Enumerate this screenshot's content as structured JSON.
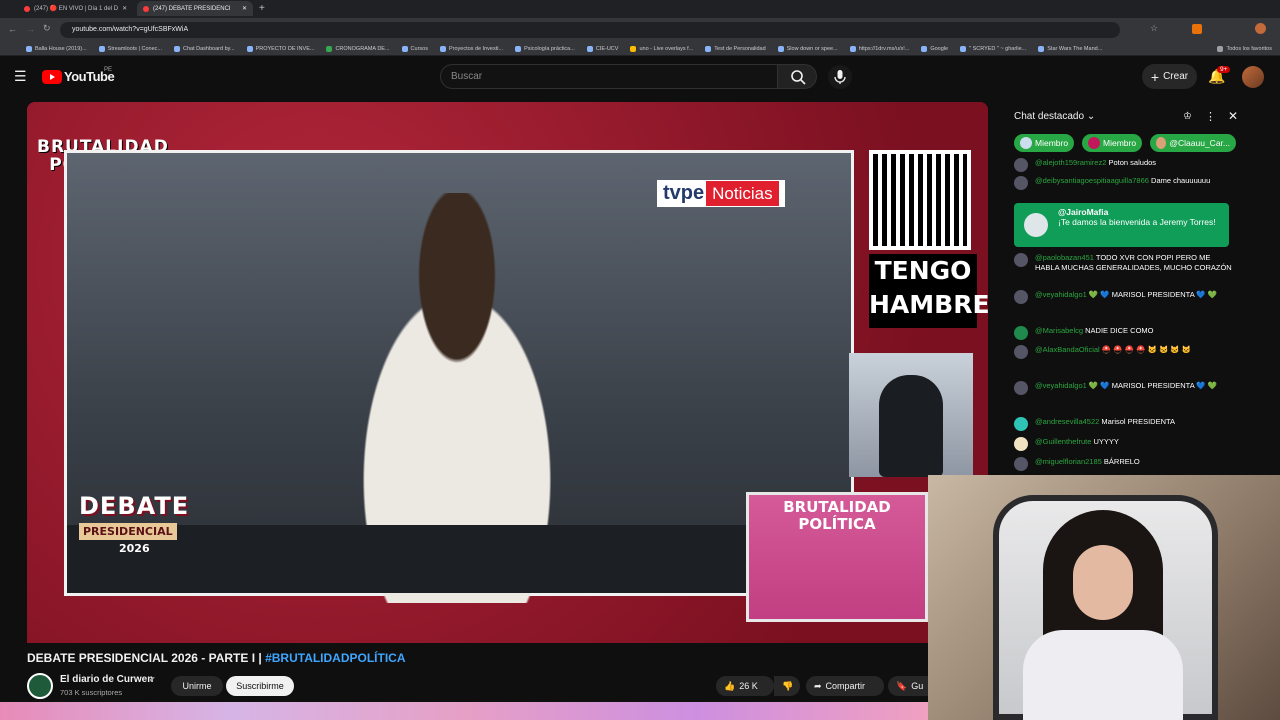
{
  "browser": {
    "tabs": [
      {
        "label": "(247) 🔴 EN VIVO | Día 1 del D"
      },
      {
        "label": "(247) DEBATE PRESIDENCI"
      }
    ],
    "url": "youtube.com/watch?v=gUfcSBFxWiA",
    "bookmarks": [
      "Balla House (2019)...",
      "Streamloots | Conec...",
      "Chat Dashboard by...",
      "PROYECTO DE INVE...",
      "CRONOGRAMA DE...",
      "Cursos",
      "Proyectos de Investi...",
      "Psicología práctica...",
      "CIE-UCV",
      "uno - Live overlays f...",
      "Test de Personalidad",
      "Slow down or spee...",
      "https://1drv.ms/u/s!...",
      "Google",
      "\" SCRYED \" ~ gharlie...",
      "Star Wars The Mand..."
    ],
    "all_bookmarks": "Todos los favoritos"
  },
  "youtube": {
    "logo": "YouTube",
    "country": "PE",
    "search_placeholder": "Buscar",
    "create_label": "Crear",
    "notif_count": "9+"
  },
  "video": {
    "brand_overlay": "BRUTALIDAD POLÍTICA",
    "tvpe": "tvpe",
    "tvpe_news": "Noticias",
    "tengo": "TENGO",
    "hambre": "HAMBRE",
    "debate": "DEBATE",
    "presidencial": "PRESIDENCIAL",
    "year": "2026",
    "pip_text": "BRUTALIDAD POLÍTICA"
  },
  "meta": {
    "title": "DEBATE PRESIDENCIAL 2026 - PARTE I | ",
    "hashtag": "#BRUTALIDADPOLÍTICA",
    "channel": "El diario de Curwen",
    "subscribers": "703 K suscriptores",
    "join": "Unirme",
    "subscribe": "Suscribirme",
    "likes": "26 K",
    "share": "Compartir",
    "save": "Gu"
  },
  "chat": {
    "header": "Chat destacado",
    "badges": [
      "Miembro",
      "Miembro",
      "@Claauu_Car..."
    ],
    "pinned_user": "@JairoMafia",
    "pinned_text": "¡Te damos la bienvenida a Jeremy Torres!",
    "messages": [
      {
        "user": "@alejoth159ramirez2",
        "text": "Poton saludos"
      },
      {
        "user": "@deibysantiagoespitiaaguilla7866",
        "text": "Dame chauuuuuu"
      },
      {
        "user": "@paolobazan451",
        "text": "TODO XVR CON POPI PERO ME HABLA MUCHAS GENERALIDADES, MUCHO CORAZÓN"
      },
      {
        "user": "@veyahidalgo1",
        "text": "💚 💙 MARISOL PRESIDENTA 💙 💚"
      },
      {
        "user": "@Marisabelcg",
        "text": "NADIE DICE COMO"
      },
      {
        "user": "@AlaxBandaOficial",
        "text": "⛑️ ⛑️ ⛑️ ⛑️ 🐱 🐱 🐱 🐱"
      },
      {
        "user": "@veyahidalgo1",
        "text": "💚 💙 MARISOL PRESIDENTA 💙 💚"
      },
      {
        "user": "@andresevilla4522",
        "text": "Marisol PRESIDENTA"
      },
      {
        "user": "@Guillenthefrute",
        "text": "UYYYY"
      },
      {
        "user": "@miguelflorian2185",
        "text": "BÁRRELO"
      }
    ]
  }
}
